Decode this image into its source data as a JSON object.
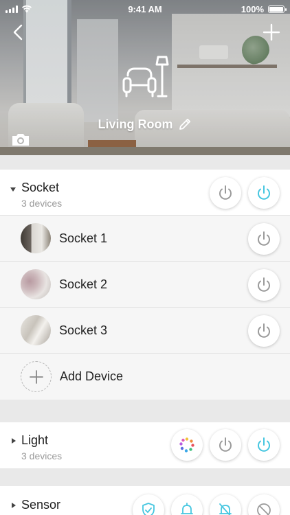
{
  "status_bar": {
    "time": "9:41 AM",
    "battery": "100%"
  },
  "header": {
    "room_name": "Living Room",
    "back_icon": "chevron-left-icon",
    "add_icon": "plus-icon",
    "room_icon": "armchair-lamp-icon",
    "edit_icon": "pencil-icon",
    "camera_icon": "camera-icon"
  },
  "colors": {
    "accent": "#45c6e0",
    "off": "#9a9a9a",
    "subtitle": "#9a9a9a"
  },
  "groups": [
    {
      "name": "Socket",
      "subtitle": "3 devices",
      "expanded": true,
      "devices": [
        {
          "name": "Socket 1"
        },
        {
          "name": "Socket 2"
        },
        {
          "name": "Socket 3"
        }
      ],
      "add_label": "Add Device"
    },
    {
      "name": "Light",
      "subtitle": "3 devices",
      "expanded": false
    },
    {
      "name": "Sensor",
      "expanded": false
    }
  ]
}
